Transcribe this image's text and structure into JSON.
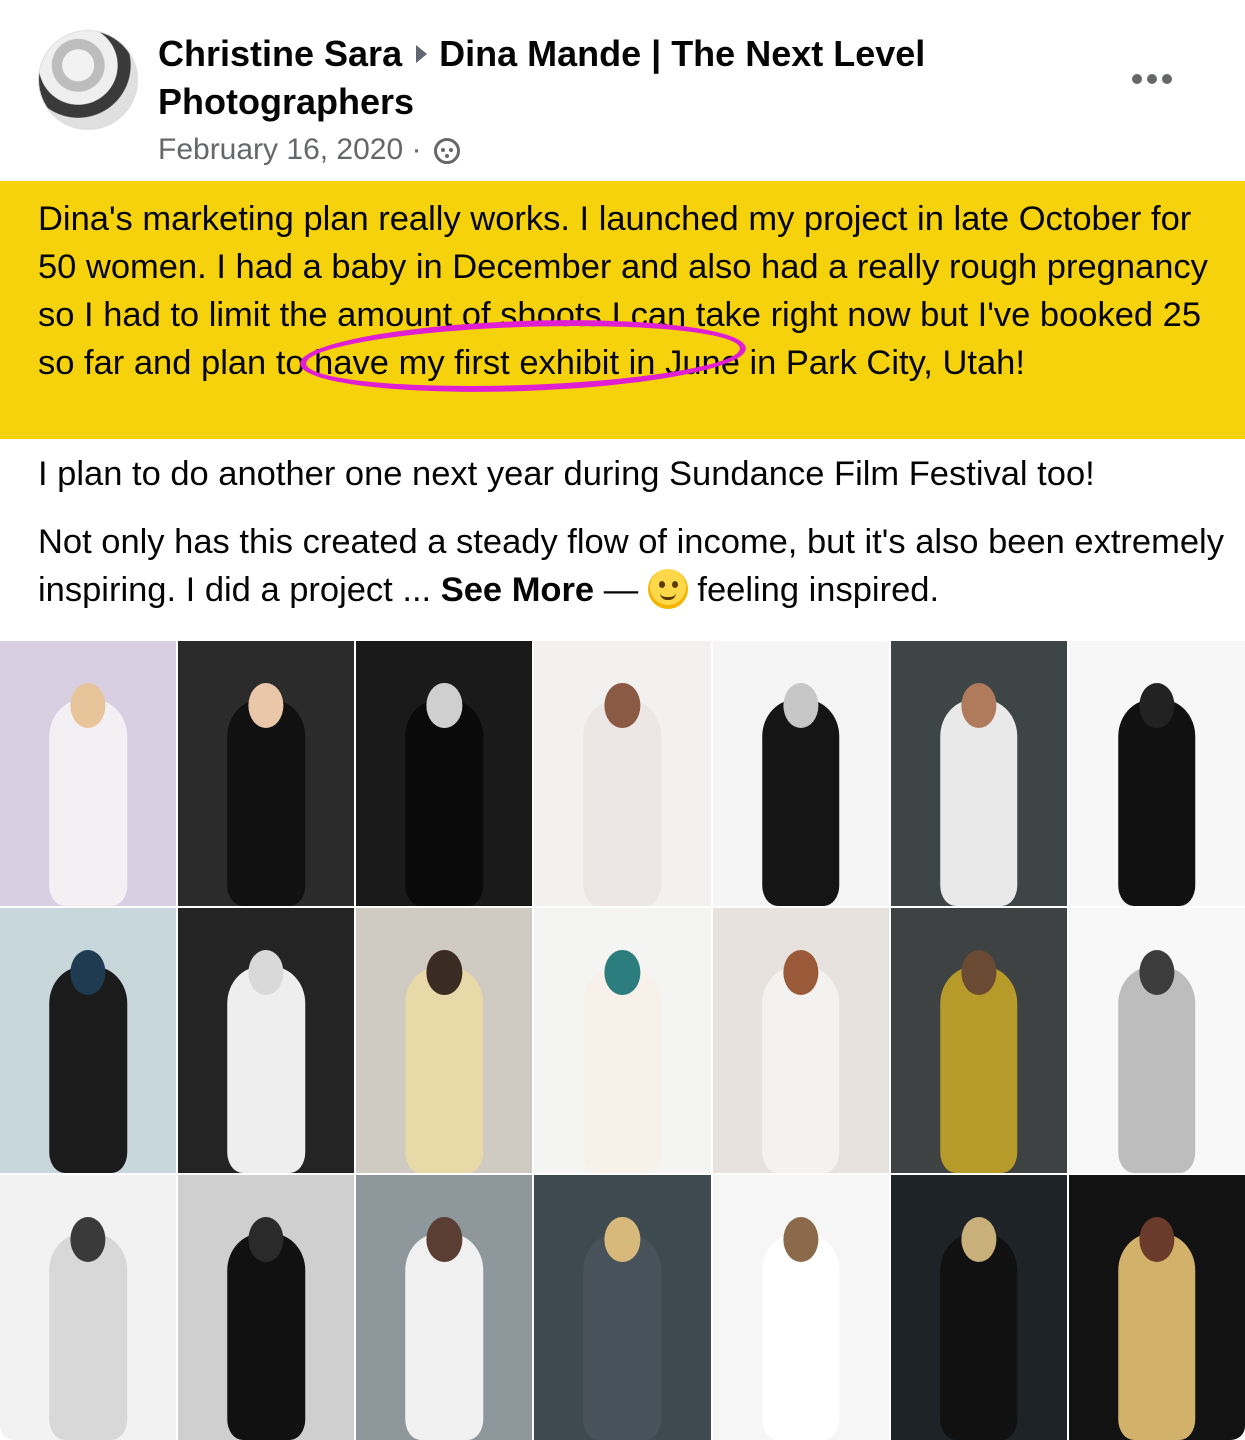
{
  "post": {
    "author": "Christine Sara",
    "group": "Dina Mande | The Next Level Photographers",
    "date": "February 16, 2020 ·",
    "more_icon": "more-horizontal-icon",
    "audience_icon": "group-members-icon",
    "highlight_text": "Dina's marketing plan really works. I launched my project in late October for 50 women. I had a baby in December and also had a really rough pregnancy so I had to limit the amount of shoots I can take right now but I've booked 25 so far and plan to have my first exhibit in June in Park City, Utah!",
    "paragraph2": "I plan to do another one next year during Sundance Film Festival too!",
    "paragraph3": "Not only has this created a steady flow of income, but it's also been extremely inspiring. I did a project ...",
    "see_more": "See More",
    "feeling_separator": " — ",
    "feeling_icon": "smiling-face-icon",
    "feeling": "feeling inspired.",
    "highlight_color": "#f6d20c",
    "annotation_color": "#e01fd3"
  },
  "photos": [
    {
      "bg": "#d9cfe3",
      "fig": "#f3f0f4",
      "head": "#e8c49a"
    },
    {
      "bg": "#2b2b2b",
      "fig": "#111111",
      "head": "#e9c7a8"
    },
    {
      "bg": "#1a1a1a",
      "fig": "#0a0a0a",
      "head": "#cfcfcf"
    },
    {
      "bg": "#f3f1f0",
      "fig": "#ece7e4",
      "head": "#8a5a44"
    },
    {
      "bg": "#f5f5f5",
      "fig": "#151515",
      "head": "#c7c7c7"
    },
    {
      "bg": "#3e4547",
      "fig": "#e9e9ea",
      "head": "#b07a5d"
    },
    {
      "bg": "#f7f7f7",
      "fig": "#111111",
      "head": "#222222"
    },
    {
      "bg": "#c7d7dc",
      "fig": "#1b1b1b",
      "head": "#1e3b52"
    },
    {
      "bg": "#242424",
      "fig": "#eeeeee",
      "head": "#d9d9d9"
    },
    {
      "bg": "#cfcac2",
      "fig": "#ead9a8",
      "head": "#3a2b23"
    },
    {
      "bg": "#f4f4f2",
      "fig": "#f7f1ea",
      "head": "#2b7d7e"
    },
    {
      "bg": "#e7e2dd",
      "fig": "#f3f2f0",
      "head": "#9a5a3a"
    },
    {
      "bg": "#3f4242",
      "fig": "#b69b2a",
      "head": "#6b4a33"
    },
    {
      "bg": "#f8f8f8",
      "fig": "#bdbdbd",
      "head": "#3c3c3c"
    },
    {
      "bg": "#f2f2f2",
      "fig": "#d8d8d8",
      "head": "#3a3a3a"
    },
    {
      "bg": "#cfcfcf",
      "fig": "#111111",
      "head": "#2a2a2a"
    },
    {
      "bg": "#8d979c",
      "fig": "#f1f1f1",
      "head": "#5a3e33"
    },
    {
      "bg": "#3d4a4f",
      "fig": "#47525a",
      "head": "#d7b97c"
    },
    {
      "bg": "#f6f6f6",
      "fig": "#ffffff",
      "head": "#8a6a4a"
    },
    {
      "bg": "#1d2326",
      "fig": "#111111",
      "head": "#c9b07a"
    },
    {
      "bg": "#121212",
      "fig": "#d2b16a",
      "head": "#6a3a2a"
    }
  ]
}
